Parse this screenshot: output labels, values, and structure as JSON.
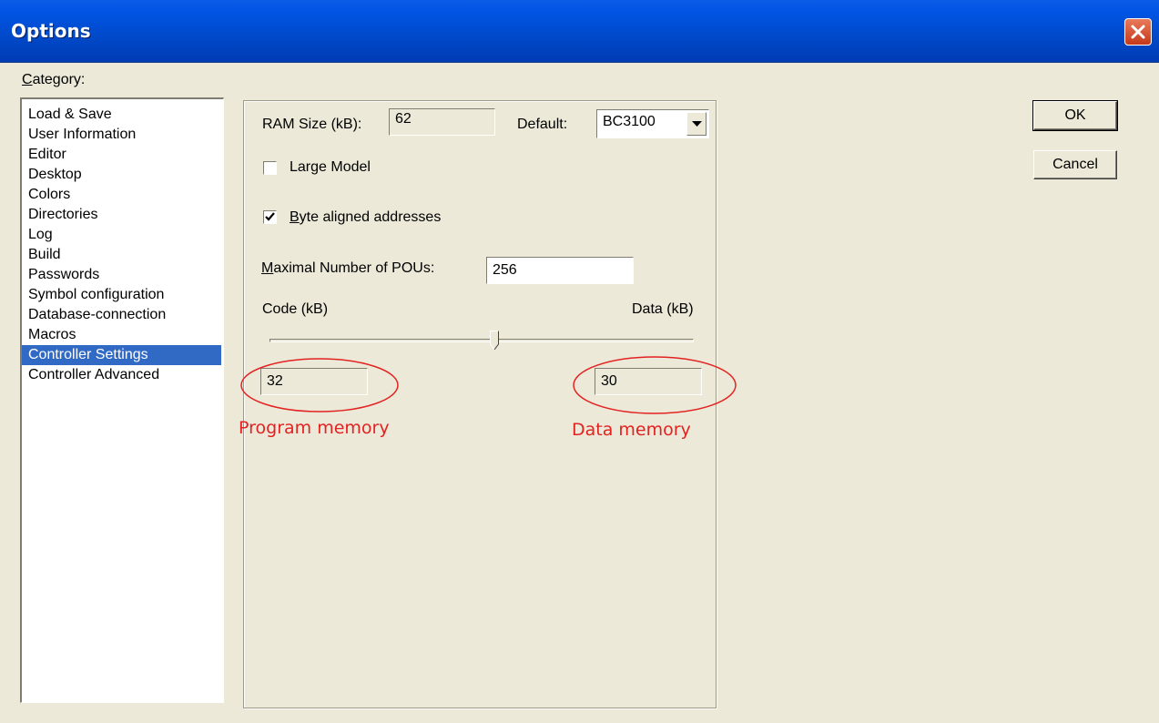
{
  "window": {
    "title": "Options",
    "close_icon": "close-icon"
  },
  "category": {
    "label_accel": "C",
    "label_rest": "ategory:",
    "items": [
      "Load & Save",
      "User Information",
      "Editor",
      "Desktop",
      "Colors",
      "Directories",
      "Log",
      "Build",
      "Passwords",
      "Symbol configuration",
      "Database-connection",
      "Macros",
      "Controller Settings",
      "Controller Advanced"
    ],
    "selected": "Controller Settings"
  },
  "settings": {
    "ram_size_label": "RAM Size (kB):",
    "ram_size_value": "62",
    "default_label": "Default:",
    "default_value": "BC3100",
    "large_model_label": "Large Model",
    "large_model_checked": false,
    "byte_aligned_accel": "B",
    "byte_aligned_rest": "yte aligned addresses",
    "byte_aligned_checked": true,
    "max_pous_accel": "M",
    "max_pous_rest": "aximal Number of POUs:",
    "max_pous_value": "256",
    "code_label": "Code (kB)",
    "data_label": "Data (kB)",
    "slider_position": 0.53,
    "code_value": "32",
    "data_value": "30"
  },
  "annotations": {
    "program_memory": "Program memory",
    "data_memory": "Data memory",
    "color": "#e32222"
  },
  "buttons": {
    "ok": "OK",
    "cancel": "Cancel"
  }
}
